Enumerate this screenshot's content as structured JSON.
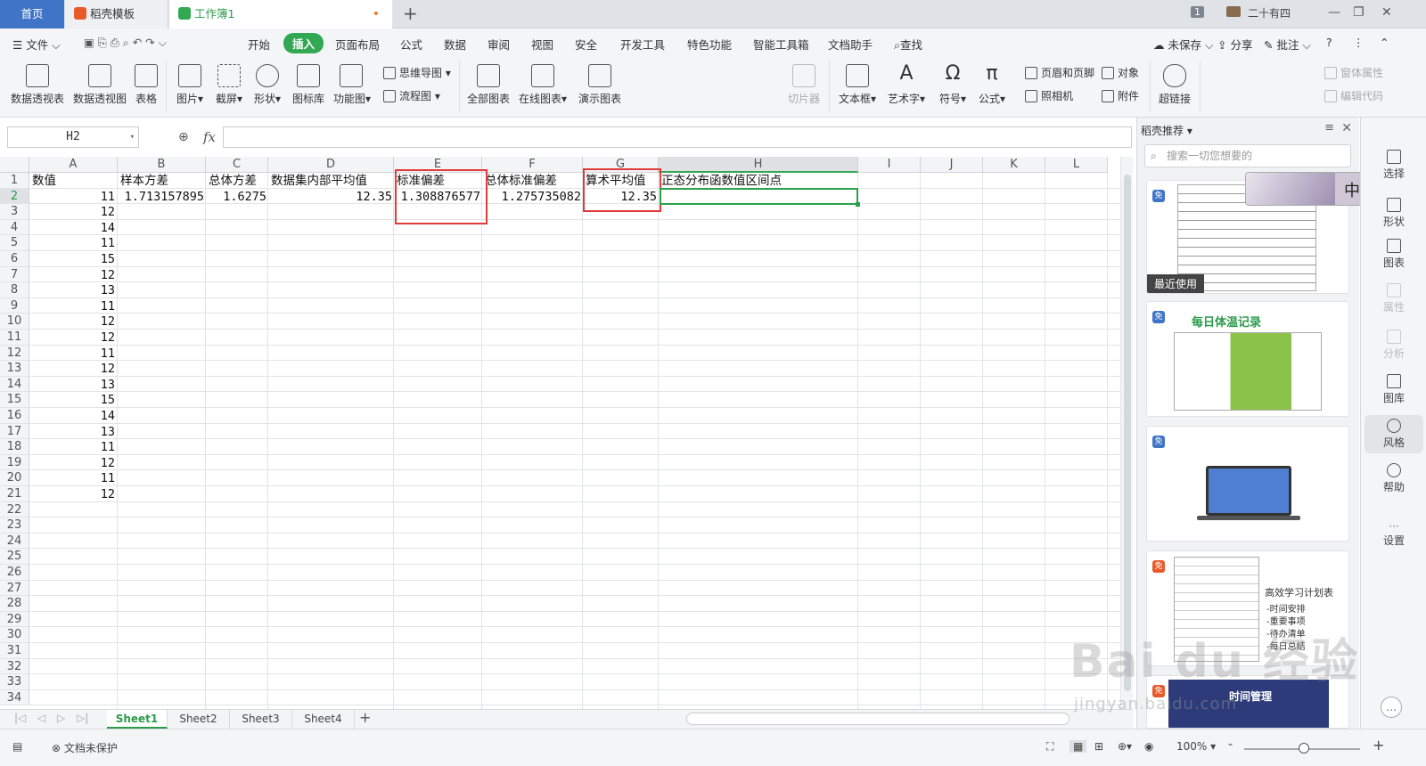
{
  "window": {
    "tabs": [
      {
        "label": "首页"
      },
      {
        "label": "稻壳模板"
      },
      {
        "label": "工作簿1",
        "modified_dot": "•"
      }
    ],
    "new_tab": "+",
    "badge_count": "1",
    "solar_term": "二十有四"
  },
  "menu": {
    "file": "文件",
    "items": [
      "开始",
      "插入",
      "页面布局",
      "公式",
      "数据",
      "审阅",
      "视图",
      "安全",
      "开发工具",
      "特色功能",
      "智能工具箱",
      "文档助手"
    ],
    "search": "查找",
    "unsaved": "未保存",
    "share": "分享",
    "annotate": "批注"
  },
  "ribbon": {
    "pivot_table": "数据透视表",
    "pivot_chart": "数据透视图",
    "table": "表格",
    "picture": "图片",
    "screenshot": "截屏",
    "shape": "形状",
    "icon_lib": "图标库",
    "func_chart": "功能图",
    "mindmap": "思维导图",
    "flowchart": "流程图",
    "all_charts": "全部图表",
    "online_charts": "在线图表",
    "demo_chart": "演示图表",
    "slicer": "切片器",
    "textbox": "文本框",
    "wordart": "艺术字",
    "symbol": "符号",
    "formula": "公式",
    "header_footer": "页眉和页脚",
    "object": "对象",
    "camera": "照相机",
    "attachment": "附件",
    "hyperlink": "超链接",
    "form_props": "窗体属性",
    "edit_code": "编辑代码"
  },
  "formula_bar": {
    "name_box": "H2",
    "fx": "fx",
    "value": ""
  },
  "sheet": {
    "columns": [
      "A",
      "B",
      "C",
      "D",
      "E",
      "F",
      "G",
      "H",
      "I",
      "J",
      "K",
      "L"
    ],
    "selected_column": "H",
    "rows": [
      "1",
      "2",
      "3",
      "4",
      "5",
      "6",
      "7",
      "8",
      "9",
      "10",
      "11",
      "12",
      "13",
      "14",
      "15",
      "16",
      "17",
      "18",
      "19",
      "20",
      "21",
      "22",
      "23",
      "24",
      "25",
      "26",
      "27",
      "28",
      "29",
      "30",
      "31",
      "32",
      "33",
      "34"
    ],
    "selected_row": "2",
    "headers": {
      "A": "数值",
      "B": "样本方差",
      "C": "总体方差",
      "D": "数据集内部平均值",
      "E": "标准偏差",
      "F": "总体标准偏差",
      "G": "算术平均值",
      "H": "正态分布函数值区间点"
    },
    "row2": {
      "B": "1.713157895",
      "C": "1.6275",
      "D": "12.35",
      "E": "1.308876577",
      "F": "1.275735082",
      "G": "12.35"
    },
    "column_a_values": [
      "11",
      "12",
      "14",
      "11",
      "15",
      "12",
      "13",
      "11",
      "12",
      "12",
      "11",
      "12",
      "13",
      "15",
      "14",
      "13",
      "11",
      "12",
      "11",
      "12"
    ],
    "highlighted_cells": [
      "E1:E2",
      "G1:G2"
    ],
    "tabs": [
      "Sheet1",
      "Sheet2",
      "Sheet3",
      "Sheet4"
    ],
    "active_tab": "Sheet1"
  },
  "status": {
    "protect": "文档未保护",
    "zoom": "100%",
    "minus": "-",
    "plus": "+"
  },
  "panel": {
    "title": "稻壳推荐",
    "search_placeholder": "搜索一切您想要的",
    "recent_label": "最近使用",
    "free_badge": "免",
    "cards": [
      "每日体温记录",
      "高效学习计划表",
      "时间管理"
    ],
    "plan_items": [
      "-时间安排",
      "-重要事项",
      "-待办清单",
      "-每日总结"
    ]
  },
  "sidebar": {
    "items": [
      "选择",
      "形状",
      "图表",
      "属性",
      "分析",
      "图库",
      "风格",
      "帮助",
      "设置"
    ]
  },
  "ime": {
    "char": "中"
  },
  "watermark": {
    "main": "Bai du 经验",
    "url": "jingyan.baidu.com"
  }
}
